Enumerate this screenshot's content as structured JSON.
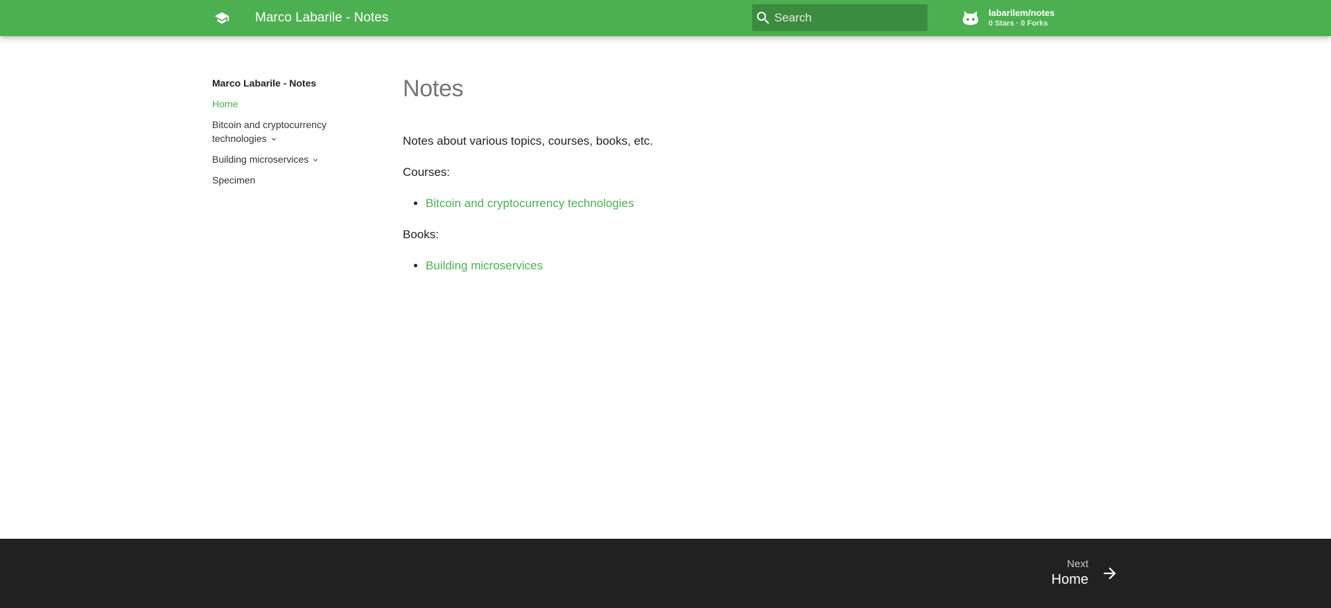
{
  "header": {
    "title": "Marco Labarile - Notes",
    "search_placeholder": "Search",
    "repo_name": "labarilem/notes",
    "repo_facts": "0 Stars · 0 Forks"
  },
  "nav": {
    "title": "Marco Labarile - Notes",
    "items": [
      {
        "label": "Home"
      },
      {
        "label": "Bitcoin and cryptocurrency technologies"
      },
      {
        "label": "Building microservices"
      },
      {
        "label": "Specimen"
      }
    ]
  },
  "content": {
    "heading": "Notes",
    "intro": "Notes about various topics, courses, books, etc.",
    "courses_label": "Courses:",
    "courses": [
      "Bitcoin and cryptocurrency technologies"
    ],
    "books_label": "Books:",
    "books": [
      "Building microservices"
    ]
  },
  "footer": {
    "next_direction": "Next",
    "next_title": "Home"
  },
  "colors": {
    "primary": "#4caf50",
    "footer": "#212121"
  }
}
